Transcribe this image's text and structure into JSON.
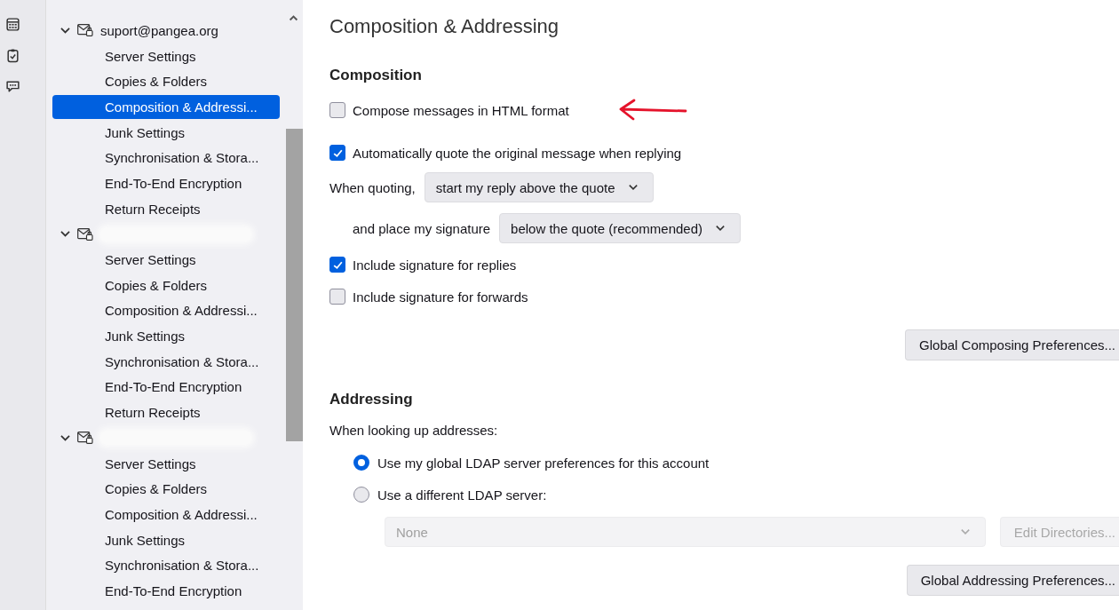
{
  "sidebar": {
    "accounts": [
      {
        "name": "suport@pangea.org",
        "expanded": true,
        "items": [
          {
            "label": "Server Settings",
            "selected": false
          },
          {
            "label": "Copies & Folders",
            "selected": false
          },
          {
            "label": "Composition & Addressi...",
            "selected": true
          },
          {
            "label": "Junk Settings",
            "selected": false
          },
          {
            "label": "Synchronisation & Stora...",
            "selected": false
          },
          {
            "label": "End-To-End Encryption",
            "selected": false
          },
          {
            "label": "Return Receipts",
            "selected": false
          }
        ]
      },
      {
        "expanded": true,
        "items": [
          {
            "label": "Server Settings",
            "selected": false
          },
          {
            "label": "Copies & Folders",
            "selected": false
          },
          {
            "label": "Composition & Addressi...",
            "selected": false
          },
          {
            "label": "Junk Settings",
            "selected": false
          },
          {
            "label": "Synchronisation & Stora...",
            "selected": false
          },
          {
            "label": "End-To-End Encryption",
            "selected": false
          },
          {
            "label": "Return Receipts",
            "selected": false
          }
        ]
      },
      {
        "expanded": true,
        "items": [
          {
            "label": "Server Settings",
            "selected": false
          },
          {
            "label": "Copies & Folders",
            "selected": false
          },
          {
            "label": "Composition & Addressi...",
            "selected": false
          },
          {
            "label": "Junk Settings",
            "selected": false
          },
          {
            "label": "Synchronisation & Stora...",
            "selected": false
          },
          {
            "label": "End-To-End Encryption",
            "selected": false
          }
        ]
      }
    ]
  },
  "page": {
    "title": "Composition & Addressing",
    "composition": {
      "heading": "Composition",
      "html_format": {
        "label": "Compose messages in HTML format",
        "checked": false
      },
      "auto_quote": {
        "label": "Automatically quote the original message when replying",
        "checked": true
      },
      "quoting": {
        "label": "When quoting,",
        "value": "start my reply above the quote"
      },
      "signature_place": {
        "label": "and place my signature",
        "value": "below the quote (recommended)"
      },
      "sig_replies": {
        "label": "Include signature for replies",
        "checked": true
      },
      "sig_forwards": {
        "label": "Include signature for forwards",
        "checked": false
      },
      "button": "Global Composing Preferences..."
    },
    "addressing": {
      "heading": "Addressing",
      "prompt": "When looking up addresses:",
      "options": [
        {
          "label": "Use my global LDAP server preferences for this account",
          "selected": true
        },
        {
          "label": "Use a different LDAP server:",
          "selected": false
        }
      ],
      "directory": {
        "value": "None",
        "disabled": true
      },
      "edit_button": {
        "label": "Edit Directories...",
        "disabled": true
      },
      "button": "Global Addressing Preferences..."
    }
  }
}
